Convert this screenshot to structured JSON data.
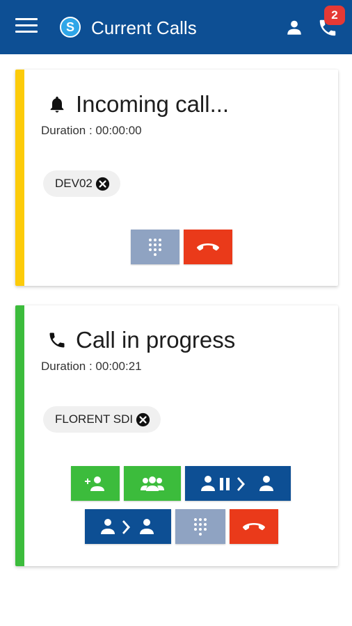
{
  "appbar": {
    "title": "Current Calls",
    "badge_count": "2",
    "icons": [
      "menu-icon",
      "skype-logo-icon",
      "user-icon",
      "phone-icon"
    ]
  },
  "colors": {
    "appbar": "#0d4f94",
    "incoming_stripe": "#fccb0a",
    "in_progress_stripe": "#3cbc3c",
    "hangup_red": "#ea3a1a",
    "keypad_gray": "#8fa3c2",
    "action_green": "#3cbc3c",
    "action_blue": "#0d4f94",
    "badge_red": "#e53935"
  },
  "calls": [
    {
      "status": "Incoming call...",
      "duration": "Duration : 00:00:00",
      "participant": "DEV02",
      "icon": "bell-icon",
      "actions": [
        "dialpad-icon",
        "hang-up-icon"
      ]
    },
    {
      "status": "Call in progress",
      "duration": "Duration : 00:00:21",
      "participant": "FLORENT SDI",
      "icon": "phone-icon",
      "actions": [
        "add-participant-icon",
        "group-icon",
        "hold-transfer-icon",
        "transfer-icon",
        "dialpad-icon",
        "hang-up-icon"
      ]
    }
  ]
}
